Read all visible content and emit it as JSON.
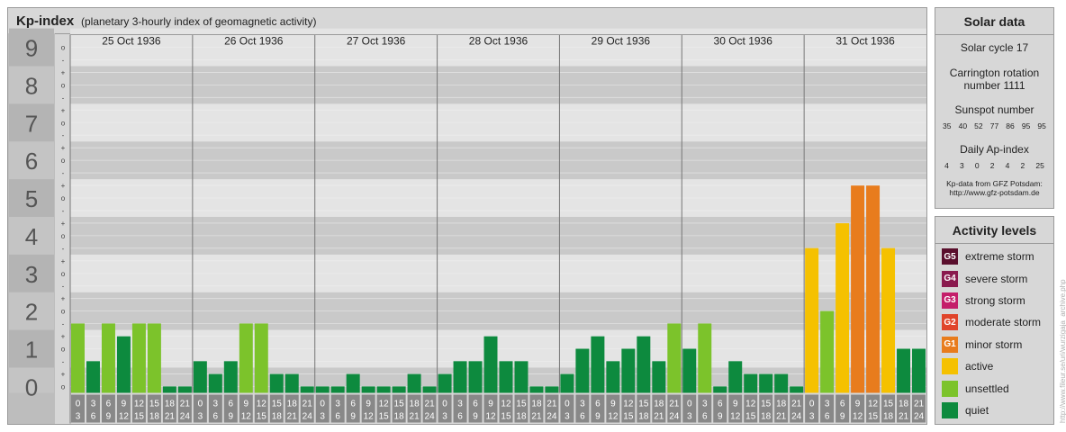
{
  "header": {
    "title": "Kp-index",
    "subtitle": "(planetary 3-hourly index of geomagnetic activity)"
  },
  "solar": {
    "title": "Solar data",
    "cycle": "Solar cycle 17",
    "carrington_line1": "Carrington rotation",
    "carrington_line2": "number 1111",
    "sunspot_title": "Sunspot number",
    "sunspots": [
      "35",
      "40",
      "52",
      "77",
      "86",
      "95",
      "95"
    ],
    "ap_title": "Daily Ap-index",
    "ap": [
      "4",
      "3",
      "0",
      "2",
      "4",
      "2",
      "25"
    ],
    "source_line1": "Kp-data from GFZ Potsdam:",
    "source_line2": "http://www.gfz-potsdam.de"
  },
  "activity": {
    "title": "Activity levels",
    "levels": [
      {
        "code": "G5",
        "label": "extreme storm",
        "color": "#5a0f2d"
      },
      {
        "code": "G4",
        "label": "severe storm",
        "color": "#8a1a4e"
      },
      {
        "code": "G3",
        "label": "strong storm",
        "color": "#c41e6a"
      },
      {
        "code": "G2",
        "label": "moderate storm",
        "color": "#e0452b"
      },
      {
        "code": "G1",
        "label": "minor storm",
        "color": "#e87c1d"
      },
      {
        "code": "",
        "label": "active",
        "color": "#f5c100"
      },
      {
        "code": "",
        "label": "unsettled",
        "color": "#7cc32b"
      },
      {
        "code": "",
        "label": "quiet",
        "color": "#0d8a3e"
      }
    ]
  },
  "credit": "http://www.fileur.se/uri/wurzigaja_archive.php",
  "chart_data": {
    "type": "bar",
    "title": "Kp-index",
    "ylim": [
      0,
      9
    ],
    "y_ticks": [
      "0",
      "1",
      "2",
      "3",
      "4",
      "5",
      "6",
      "7",
      "8",
      "9"
    ],
    "minor_marks": [
      "o",
      "+",
      "-"
    ],
    "days": [
      "25 Oct 1936",
      "26 Oct 1936",
      "27 Oct 1936",
      "28 Oct 1936",
      "29 Oct 1936",
      "30 Oct 1936",
      "31 Oct 1936"
    ],
    "hour_starts": [
      "0",
      "3",
      "6",
      "9",
      "12",
      "15",
      "18",
      "21"
    ],
    "hour_ends": [
      "3",
      "6",
      "9",
      "12",
      "15",
      "18",
      "21",
      "24"
    ],
    "colors": {
      "quiet": "#0d8a3e",
      "unsettled": "#7cc32b",
      "active": "#f5c100",
      "minor": "#e87c1d"
    },
    "values": [
      [
        1.67,
        0.67,
        1.67,
        1.33,
        1.67,
        1.67,
        0,
        0
      ],
      [
        0.67,
        0.33,
        0.67,
        1.67,
        1.67,
        0.33,
        0.33,
        0
      ],
      [
        0,
        0,
        0.33,
        0,
        0,
        0,
        0.33,
        0
      ],
      [
        0.33,
        0.67,
        0.67,
        1.33,
        0.67,
        0.67,
        0,
        0
      ],
      [
        0.33,
        1,
        1.33,
        0.67,
        1,
        1.33,
        0.67,
        1.67
      ],
      [
        1,
        1.67,
        0,
        0.67,
        0.33,
        0.33,
        0.33,
        0
      ],
      [
        3.67,
        2,
        4.33,
        5.33,
        5.33,
        3.67,
        1,
        1
      ]
    ]
  }
}
